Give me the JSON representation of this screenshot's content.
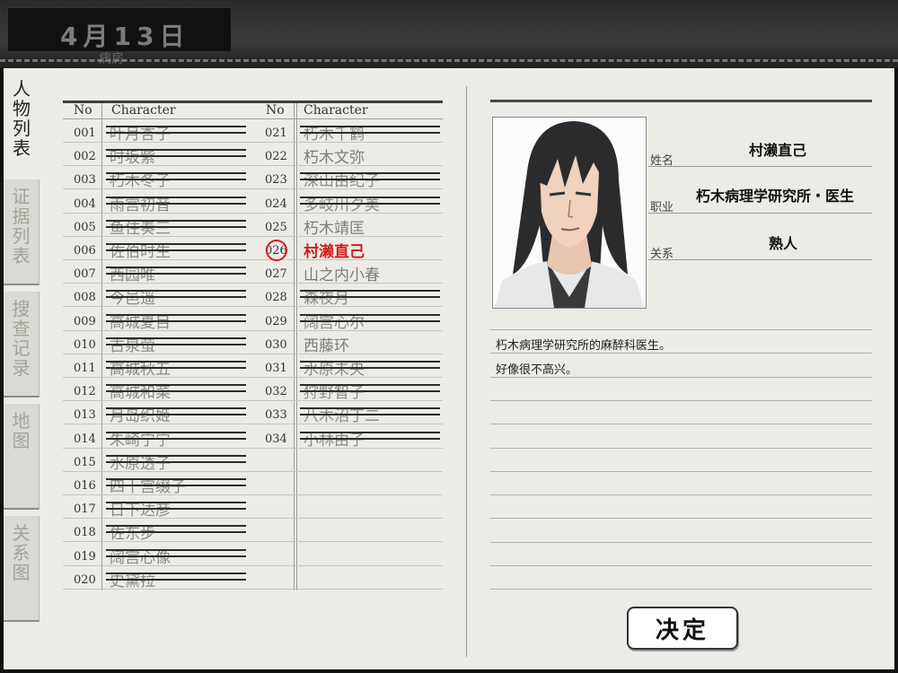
{
  "header": {
    "date": "4月13日",
    "location": "病房"
  },
  "tabs": [
    {
      "label": "人物列表",
      "active": true
    },
    {
      "label": "证据列表",
      "active": false
    },
    {
      "label": "搜查记录",
      "active": false
    },
    {
      "label": "地图",
      "active": false
    },
    {
      "label": "关系图",
      "active": false
    }
  ],
  "table": {
    "col_no": "No",
    "col_character": "Character",
    "left": [
      {
        "no": "001",
        "name": "叶月杏子",
        "struck": true
      },
      {
        "no": "002",
        "name": "时坂紫",
        "struck": true
      },
      {
        "no": "003",
        "name": "朽木冬子",
        "struck": true
      },
      {
        "no": "004",
        "name": "雨宫初音",
        "struck": true
      },
      {
        "no": "005",
        "name": "鱼住奏三",
        "struck": true
      },
      {
        "no": "006",
        "name": "佐伯时生",
        "struck": true
      },
      {
        "no": "007",
        "name": "西园唯",
        "struck": true
      },
      {
        "no": "008",
        "name": "今邑遥",
        "struck": true
      },
      {
        "no": "009",
        "name": "高城夏目",
        "struck": true
      },
      {
        "no": "010",
        "name": "古泉萤",
        "struck": true
      },
      {
        "no": "011",
        "name": "高城秋五",
        "struck": true
      },
      {
        "no": "012",
        "name": "高城和菜",
        "struck": true
      },
      {
        "no": "013",
        "name": "月岛织姬",
        "struck": true
      },
      {
        "no": "014",
        "name": "朱崎宁宁",
        "struck": true
      },
      {
        "no": "015",
        "name": "水原透子",
        "struck": true
      },
      {
        "no": "016",
        "name": "四十宫缀子",
        "struck": true
      },
      {
        "no": "017",
        "name": "日下达彦",
        "struck": true
      },
      {
        "no": "018",
        "name": "佐东步",
        "struck": true
      },
      {
        "no": "019",
        "name": "阔宫心像",
        "struck": true
      },
      {
        "no": "020",
        "name": "史黛拉",
        "struck": true
      }
    ],
    "right": [
      {
        "no": "021",
        "name": "朽木千鹤",
        "struck": true
      },
      {
        "no": "022",
        "name": "朽木文弥",
        "struck": false
      },
      {
        "no": "023",
        "name": "深山由纪子",
        "struck": true
      },
      {
        "no": "024",
        "name": "多岐川夕美",
        "struck": true
      },
      {
        "no": "025",
        "name": "朽木靖匡",
        "struck": false
      },
      {
        "no": "026",
        "name": "村濑直己",
        "struck": false,
        "selected": true
      },
      {
        "no": "027",
        "name": "山之内小春",
        "struck": false
      },
      {
        "no": "028",
        "name": "森夜月",
        "struck": true
      },
      {
        "no": "029",
        "name": "阔宫心尔",
        "struck": true
      },
      {
        "no": "030",
        "name": "西藤环",
        "struck": false
      },
      {
        "no": "031",
        "name": "水原未央",
        "struck": true
      },
      {
        "no": "032",
        "name": "狩野智子",
        "struck": true
      },
      {
        "no": "033",
        "name": "八木沼丁二",
        "struck": true
      },
      {
        "no": "034",
        "name": "小林由子",
        "struck": true
      }
    ]
  },
  "detail": {
    "name_label": "姓名",
    "name": "村濑直己",
    "job_label": "职业",
    "job": "朽木病理学研究所・医生",
    "relation_label": "关系",
    "relation": "熟人",
    "notes": [
      "朽木病理学研究所的麻醉科医生。",
      "好像很不高兴。"
    ]
  },
  "confirm_label": "决定"
}
